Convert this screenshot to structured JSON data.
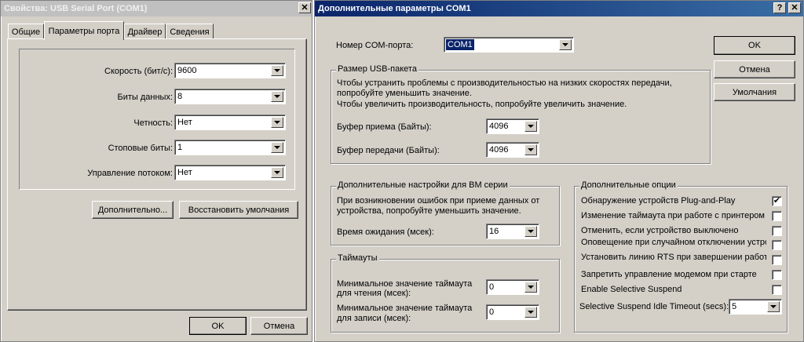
{
  "props": {
    "title": "Свойства: USB Serial Port (COM1)",
    "close": "✕",
    "tabs": [
      "Общие",
      "Параметры порта",
      "Драйвер",
      "Сведения"
    ],
    "fields": [
      {
        "label": "Скорость (бит/с):",
        "value": "9600"
      },
      {
        "label": "Биты данных:",
        "value": "8"
      },
      {
        "label": "Четность:",
        "value": "Нет"
      },
      {
        "label": "Стоповые биты:",
        "value": "1"
      },
      {
        "label": "Управление потоком:",
        "value": "Нет"
      }
    ],
    "advanced_button": "Дополнительно...",
    "restore_button": "Восстановить умолчания",
    "ok": "OK",
    "cancel": "Отмена"
  },
  "adv": {
    "title": "Дополнительные параметры COM1",
    "help": "?",
    "close": "✕",
    "com_label": "Номер COM-порта:",
    "com_value": "COM1",
    "ok": "OK",
    "cancel": "Отмена",
    "defaults": "Умолчания",
    "usb": {
      "legend": "Размер USB-пакета",
      "text1": "Чтобы устранить проблемы с производительностью на низких скоростях передачи,",
      "text2": "попробуйте уменьшить значение.",
      "text3": "Чтобы увеличить производительность, попробуйте увеличить значение.",
      "rx_label": "Буфер приема (Байты):",
      "rx_value": "4096",
      "tx_label": "Буфер передачи (Байты):",
      "tx_value": "4096"
    },
    "bm": {
      "legend": "Дополнительные настройки для BM серии",
      "text1": "При возникновении ошибок при приеме данных от",
      "text2": "устройства, попробуйте уменьшить значение.",
      "latency_label": "Время ожидания (мсек):",
      "latency_value": "16"
    },
    "timeouts": {
      "legend": "Таймауты",
      "read_label1": "Минимальное значение таймаута",
      "read_label2": "для чтения (мсек):",
      "read_value": "0",
      "write_label1": "Минимальное значение таймаута",
      "write_label2": "для записи (мсек):",
      "write_value": "0"
    },
    "options": {
      "legend": "Дополнительные опции",
      "items": [
        {
          "label": "Обнаружение устройств Plug-and-Play",
          "checked": true
        },
        {
          "label": "Изменение таймаута при работе с принтером",
          "checked": false
        },
        {
          "label": "Отменить, если устройство выключено",
          "checked": false
        },
        {
          "label": "Оповещение при случайном отключении устройства",
          "checked": false
        },
        {
          "label": "Установить линию RTS при завершении работы",
          "checked": false
        },
        {
          "label": "Запретить управление модемом при старте",
          "checked": false
        },
        {
          "label": "Enable Selective Suspend",
          "checked": false
        }
      ],
      "idle_label": "Selective Suspend Idle Timeout (secs):",
      "idle_value": "5"
    }
  }
}
